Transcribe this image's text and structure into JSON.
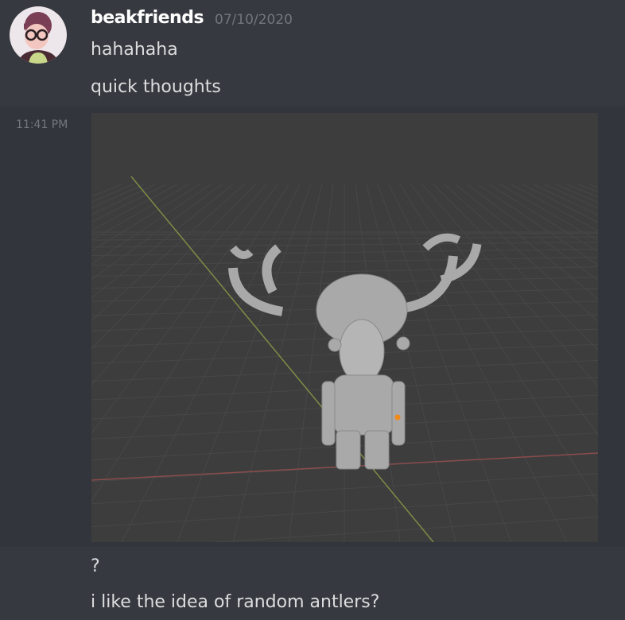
{
  "message": {
    "username": "beakfriends",
    "date": "07/10/2020"
  },
  "lines": [
    "hahahaha",
    "quick thoughts"
  ],
  "attachment": {
    "time": "11:41 PM"
  },
  "after": [
    "?",
    "i like the idea of random antlers?"
  ]
}
